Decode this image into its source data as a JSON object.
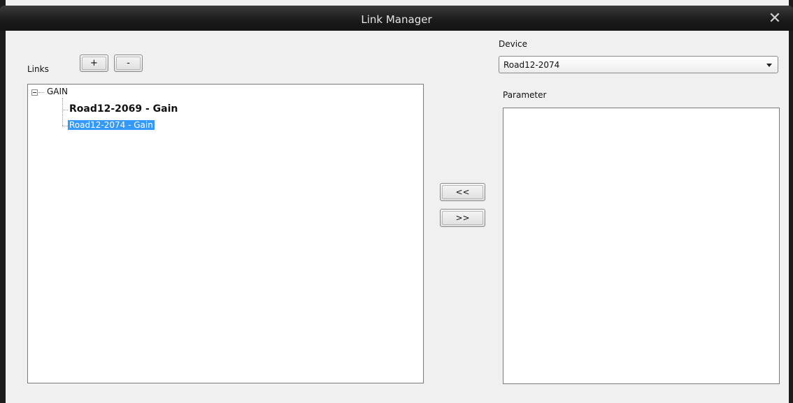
{
  "window": {
    "title": "Link Manager",
    "close_glyph": "✕"
  },
  "links": {
    "label": "Links",
    "add_label": "+",
    "remove_label": "-",
    "tree": {
      "root_label": "GAIN",
      "items": [
        {
          "label": "Road12-2069 - Gain",
          "bold": true,
          "selected": false
        },
        {
          "label": "Road12-2074 - Gain",
          "bold": false,
          "selected": true
        }
      ]
    }
  },
  "transfer": {
    "move_left_label": "<<",
    "move_right_label": ">>"
  },
  "device": {
    "label": "Device",
    "selected": "Road12-2074"
  },
  "parameter": {
    "label": "Parameter"
  },
  "colors": {
    "selection": "#3399ff",
    "titlebar": "#1a1a1a"
  }
}
